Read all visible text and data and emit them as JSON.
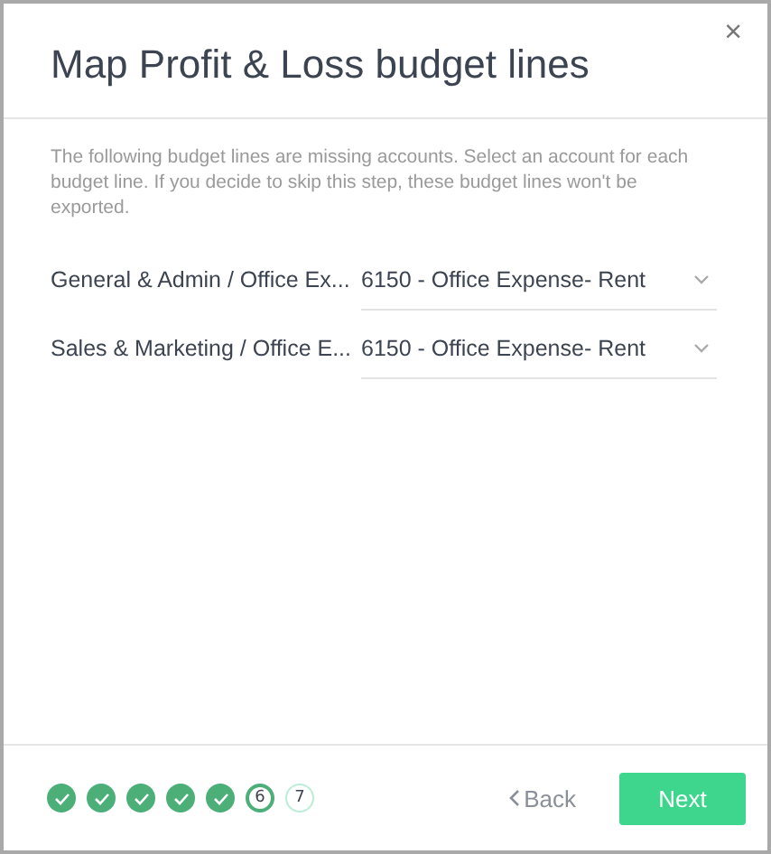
{
  "dialog": {
    "title": "Map Profit & Loss budget lines",
    "close": "×"
  },
  "description": "The following budget lines are missing accounts. Select an account for each budget line. If you decide to skip this step, these budget lines won't be exported.",
  "mappings": [
    {
      "label": "General & Admin / Office Ex...",
      "account": "6150 - Office Expense- Rent"
    },
    {
      "label": "Sales & Marketing / Office E...",
      "account": "6150 - Office Expense- Rent"
    }
  ],
  "steps": [
    {
      "completed": true,
      "selected": false
    },
    {
      "completed": true,
      "selected": false
    },
    {
      "completed": true,
      "selected": false
    },
    {
      "completed": true,
      "selected": false
    },
    {
      "completed": true,
      "selected": false
    },
    {
      "completed": false,
      "selected": true,
      "label": "6"
    },
    {
      "completed": false,
      "selected": false,
      "label": "7"
    }
  ],
  "buttons": {
    "back": "Back",
    "next": "Next"
  }
}
